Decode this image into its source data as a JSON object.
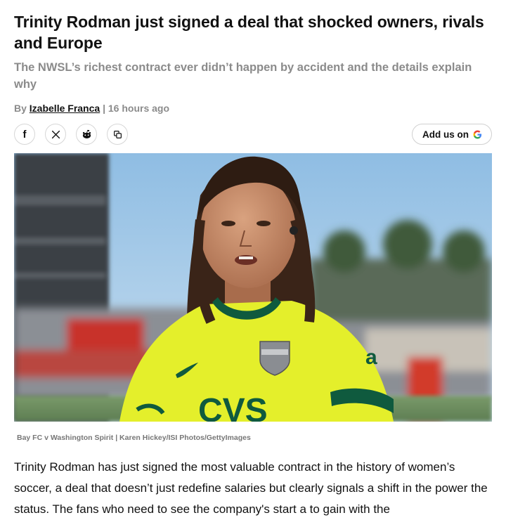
{
  "article": {
    "headline": "Trinity Rodman just signed a deal that shocked owners, rivals and Europe",
    "subheadline": "The NWSL’s richest contract ever didn’t happen by accident and the details explain why",
    "byline": {
      "prefix": "By",
      "author": "Izabelle Franca",
      "separator": "|",
      "time": "16 hours ago"
    },
    "share": {
      "icons": [
        "facebook-icon",
        "x-icon",
        "reddit-icon",
        "copy-link-icon"
      ]
    },
    "add_button": {
      "label": "Add us on",
      "icon": "google-icon"
    },
    "photo": {
      "jersey_sponsor": "CVS",
      "sleeve_text": "a"
    },
    "caption": "Bay FC v Washington Spirit | Karen Hickey/ISI Photos/GettyImages",
    "body": "Trinity Rodman has just signed the most valuable contract in the history of women’s soccer, a deal that doesn’t just redefine salaries but clearly signals a shift in the power the status. The fans who need to see the company's start a to gain with the"
  },
  "colors": {
    "text": "#111111",
    "muted": "#8b8b8b",
    "jersey": "#e3f02c",
    "jersey_trim": "#0f5a3e",
    "sky": "#a9cbe6",
    "google_blue": "#4285f4"
  }
}
